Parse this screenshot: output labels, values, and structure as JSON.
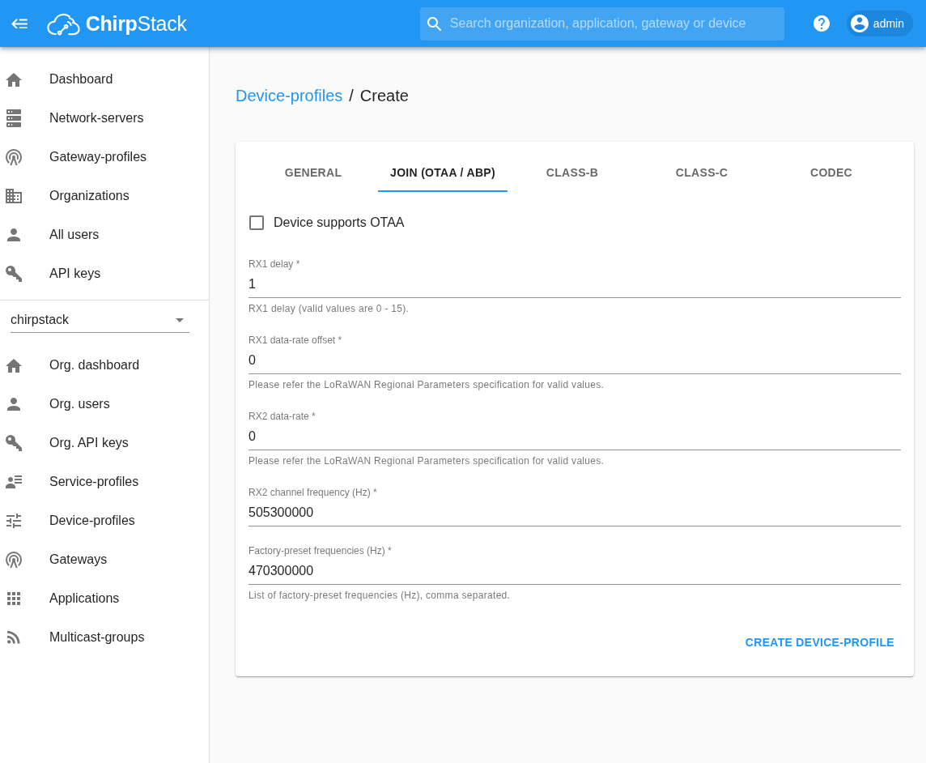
{
  "header": {
    "brand": "**Chirp**Stack",
    "search": {
      "placeholder": "Search organization, application, gateway or device"
    },
    "user": {
      "name": "admin"
    }
  },
  "sidebar": {
    "items": [
      {
        "label": "Dashboard"
      },
      {
        "label": "Network-servers"
      },
      {
        "label": "Gateway-profiles"
      },
      {
        "label": "Organizations"
      },
      {
        "label": "All users"
      },
      {
        "label": "API keys"
      }
    ],
    "organization_select": {
      "value": "chirpstack"
    },
    "org_items": [
      {
        "label": "Org. dashboard"
      },
      {
        "label": "Org. users"
      },
      {
        "label": "Org. API keys"
      },
      {
        "label": "Service-profiles"
      },
      {
        "label": "Device-profiles"
      },
      {
        "label": "Gateways"
      },
      {
        "label": "Applications"
      },
      {
        "label": "Multicast-groups"
      }
    ]
  },
  "breadcrumb": {
    "link": "Device-profiles",
    "separator": "/",
    "current": "Create"
  },
  "tabs": [
    {
      "label": "GENERAL",
      "selected": false
    },
    {
      "label": "JOIN (OTAA / ABP)",
      "selected": true
    },
    {
      "label": "CLASS-B",
      "selected": false
    },
    {
      "label": "CLASS-C",
      "selected": false
    },
    {
      "label": "CODEC",
      "selected": false
    }
  ],
  "otaa_checkbox": {
    "label": "Device supports OTAA",
    "checked": false
  },
  "fields": [
    {
      "label": "RX1 delay *",
      "value": "1",
      "helper": "RX1 delay (valid values are 0 - 15)."
    },
    {
      "label": "RX1 data-rate offset *",
      "value": "0",
      "helper": "Please refer the LoRaWAN Regional Parameters specification for valid values."
    },
    {
      "label": "RX2 data-rate *",
      "value": "0",
      "helper": "Please refer the LoRaWAN Regional Parameters specification for valid values."
    },
    {
      "label": "RX2 channel frequency (Hz) *",
      "value": "505300000"
    },
    {
      "label": "Factory-preset frequencies (Hz) *",
      "value": "470300000",
      "helper": "List of factory-preset frequencies (Hz), comma separated."
    }
  ],
  "submit_button": {
    "label": "CREATE DEVICE-PROFILE"
  }
}
